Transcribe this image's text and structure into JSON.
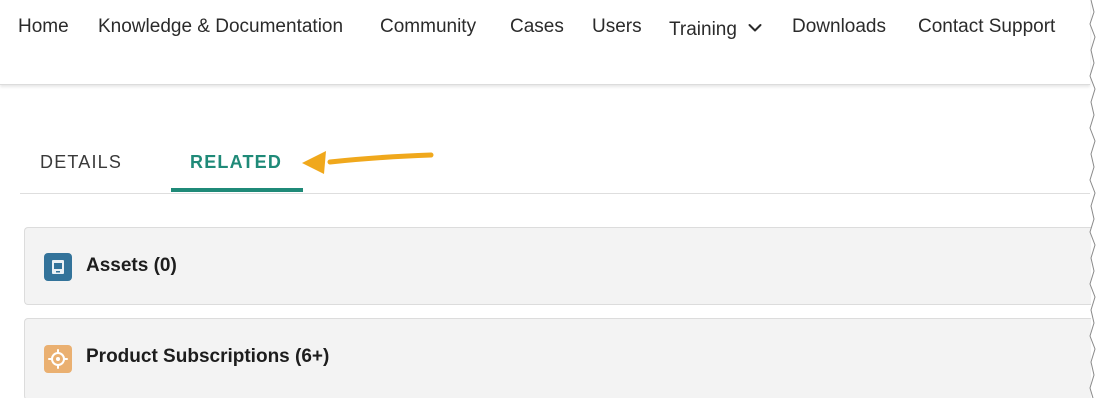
{
  "nav": {
    "items": [
      {
        "key": "home",
        "label": "Home"
      },
      {
        "key": "knowledge",
        "label": "Knowledge & Documentation"
      },
      {
        "key": "community",
        "label": "Community"
      },
      {
        "key": "cases",
        "label": "Cases"
      },
      {
        "key": "users",
        "label": "Users"
      },
      {
        "key": "training",
        "label": "Training",
        "has_dropdown": true
      },
      {
        "key": "downloads",
        "label": "Downloads"
      },
      {
        "key": "contact",
        "label": "Contact Support"
      }
    ]
  },
  "tabs": {
    "items": [
      {
        "key": "details",
        "label": "DETAILS",
        "active": false
      },
      {
        "key": "related",
        "label": "RELATED",
        "active": true
      }
    ],
    "active_color": "#1f8a78"
  },
  "related": {
    "cards": [
      {
        "key": "assets",
        "title": "Assets (0)",
        "icon": "asset-icon",
        "icon_color": "#33739a"
      },
      {
        "key": "product-subscriptions",
        "title": "Product Subscriptions (6+)",
        "icon": "subscription-icon",
        "icon_color": "#eab071"
      }
    ]
  },
  "annotation": {
    "arrow_color": "#f0a81c",
    "points_to": "RELATED"
  }
}
